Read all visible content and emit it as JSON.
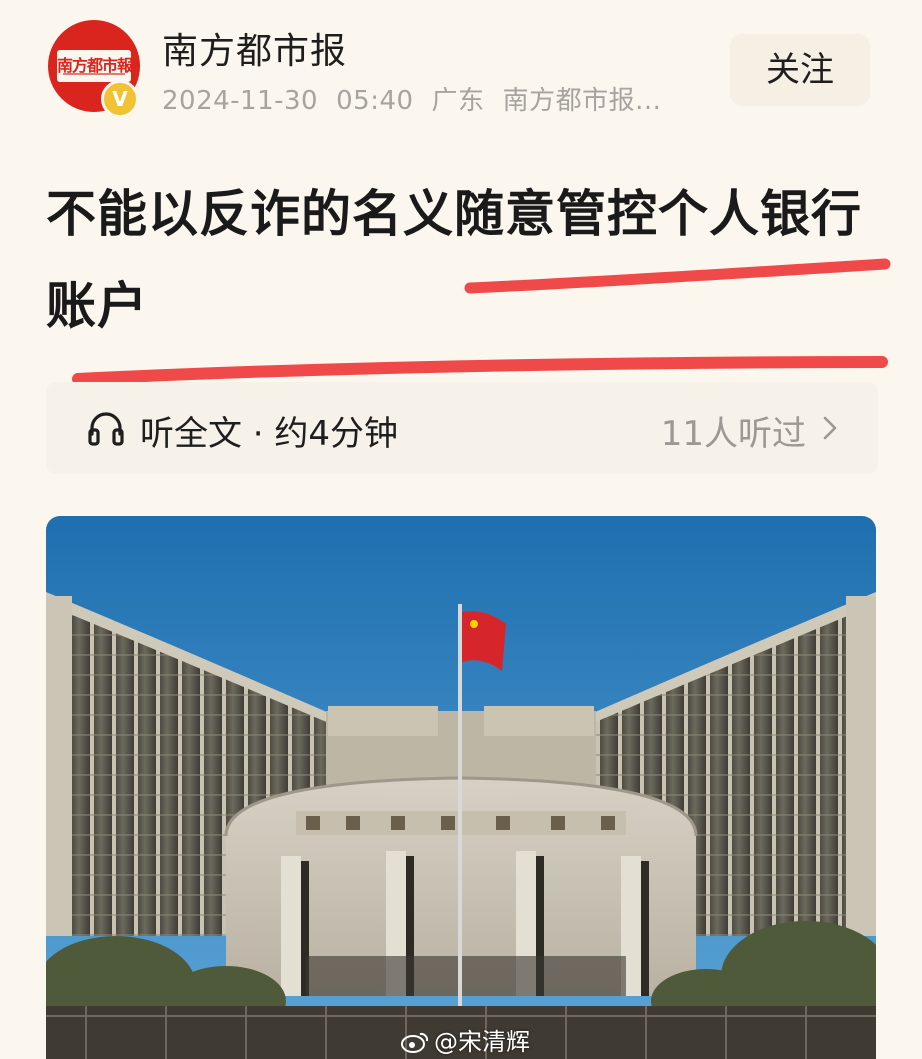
{
  "header": {
    "avatar_text": "南方都市報",
    "verified_badge": "V",
    "account_name": "南方都市报",
    "date": "2024-11-30",
    "time": "05:40",
    "location": "广东",
    "source": "南方都市报...",
    "follow_label": "关注"
  },
  "article": {
    "title": "不能以反诈的名义随意管控个人银行账户"
  },
  "listen_bar": {
    "label": "听全文 · 约4分钟",
    "listeners": "11人听过"
  },
  "watermark": {
    "text": "@宋清辉"
  },
  "icons": {
    "listen": "headphone-icon",
    "more": "chevron-right-icon",
    "watermark": "weibo-icon"
  },
  "colors": {
    "page_background": "#fbf6ee",
    "brand_red": "#d9251d",
    "verified_gold": "#f1c232",
    "meta_gray": "#a7a49f",
    "annotation_red": "#ee3b3b"
  }
}
